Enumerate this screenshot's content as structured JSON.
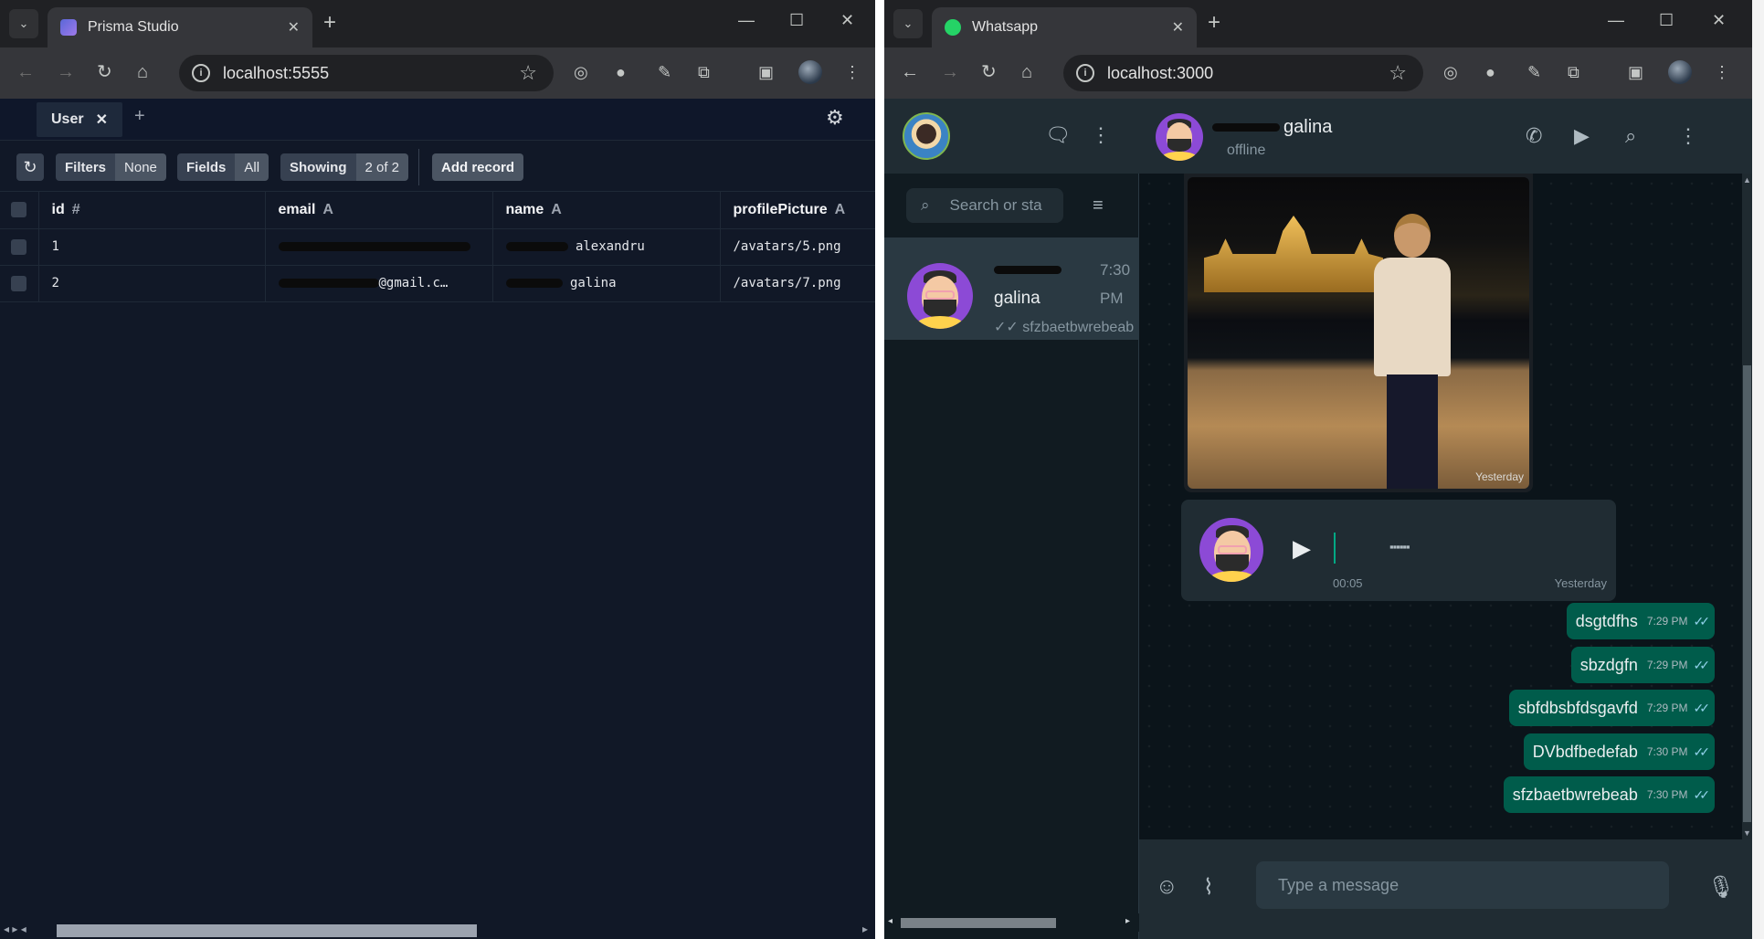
{
  "left_window": {
    "tab_title": "Prisma Studio",
    "url": "localhost:5555",
    "model_tab": "User",
    "filters": {
      "label": "Filters",
      "value": "None"
    },
    "fields": {
      "label": "Fields",
      "value": "All"
    },
    "showing": {
      "label": "Showing",
      "value": "2 of 2"
    },
    "add_record": "Add record",
    "columns": [
      {
        "name": "id",
        "type": "#"
      },
      {
        "name": "email",
        "type": "A"
      },
      {
        "name": "name",
        "type": "A"
      },
      {
        "name": "profilePicture",
        "type": "A"
      }
    ],
    "rows": [
      {
        "id": "1",
        "email": "",
        "name": "alexandru",
        "profilePicture": "/avatars/5.png"
      },
      {
        "id": "2",
        "email": "@gmail.c…",
        "name": "galina",
        "profilePicture": "/avatars/7.png"
      }
    ]
  },
  "right_window": {
    "tab_title": "Whatsapp",
    "url": "localhost:3000",
    "search_placeholder": "Search or sta",
    "chat": {
      "name": "galina",
      "time": "7:30 PM",
      "last_message": "sfzbaetbwrebeab"
    },
    "header": {
      "name": "galina",
      "status": "offline"
    },
    "photo_time": "Yesterday",
    "voice": {
      "duration": "00:05",
      "time": "Yesterday"
    },
    "messages": [
      {
        "text": "dsgtdfhs",
        "time": "7:29 PM"
      },
      {
        "text": "sbzdgfn",
        "time": "7:29 PM"
      },
      {
        "text": "sbfdbsbfdsgavfd",
        "time": "7:29 PM"
      },
      {
        "text": "DVbdfbedefab",
        "time": "7:30 PM"
      },
      {
        "text": "sfzbaetbwrebeab",
        "time": "7:30 PM"
      }
    ],
    "compose_placeholder": "Type a message"
  },
  "colors": {
    "prisma_bg": "#111827",
    "wa_bg": "#0b141a",
    "wa_outgoing": "#005c4b",
    "wa_panel": "#202c33"
  }
}
